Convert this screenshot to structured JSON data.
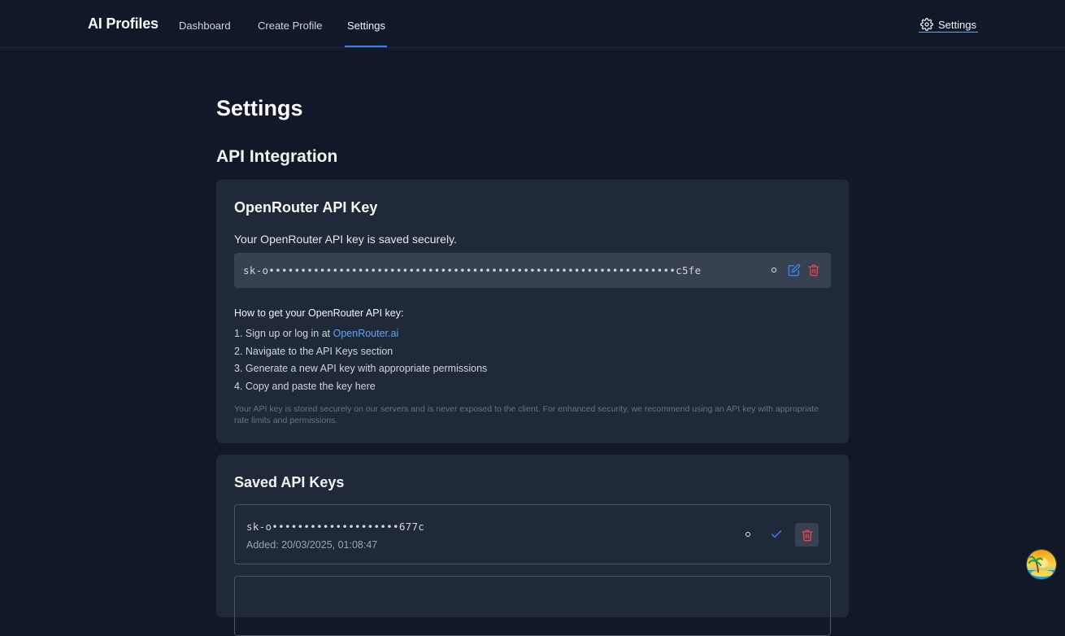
{
  "header": {
    "brand": "AI Profiles",
    "nav": [
      {
        "label": "Dashboard"
      },
      {
        "label": "Create Profile"
      },
      {
        "label": "Settings"
      }
    ],
    "settings_label": "Settings",
    "settings_icon": "gear-icon"
  },
  "page": {
    "title": "Settings",
    "section_title": "API Integration"
  },
  "openrouter_card": {
    "title": "OpenRouter API Key",
    "saved_message": "Your OpenRouter API key is saved securely.",
    "masked_key": "sk-o••••••••••••••••••••••••••••••••••••••••••••••••••••••••••••••••c5fe",
    "icons": [
      "toggle-visibility-icon",
      "edit-icon",
      "trash-icon"
    ],
    "howto_title": "How to get your OpenRouter API key:",
    "step1_prefix": "1. Sign up or log in at ",
    "step1_link": "OpenRouter.ai",
    "step2": "2. Navigate to the API Keys section",
    "step3": "3. Generate a new API key with appropriate permissions",
    "step4": "4. Copy and paste the key here",
    "note": "Your API key is stored securely on our servers and is never exposed to the client. For enhanced security, we recommend using an API key with appropriate rate limits and permissions."
  },
  "saved_keys_card": {
    "title": "Saved API Keys",
    "items": [
      {
        "masked_key": "sk-o••••••••••••••••••••677c",
        "added": "Added: 20/03/2025, 01:08:47"
      }
    ]
  },
  "colors": {
    "background": "#111827",
    "card": "#1f2937",
    "accent": "#3b82f6",
    "danger": "#ef4444",
    "link": "#60a5fa"
  }
}
